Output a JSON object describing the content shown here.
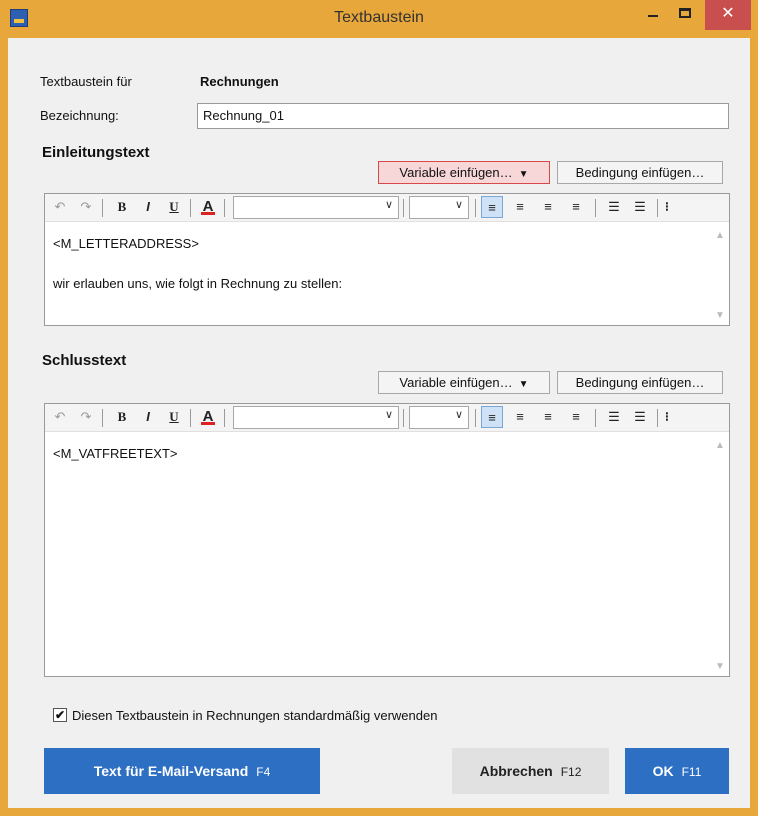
{
  "window": {
    "title": "Textbaustein",
    "close_glyph": "✕"
  },
  "form": {
    "for_label": "Textbaustein für",
    "for_value": "Rechnungen",
    "name_label": "Bezeichnung:",
    "name_value": "Rechnung_01"
  },
  "intro": {
    "title": "Einleitungstext",
    "variable_button": "Variable einfügen…",
    "condition_button": "Bedingung einfügen…",
    "content_lines": [
      "<M_LETTERADDRESS>",
      "wir erlauben uns, wie folgt in Rechnung zu stellen:"
    ]
  },
  "closing": {
    "title": "Schlusstext",
    "variable_button": "Variable einfügen…",
    "condition_button": "Bedingung einfügen…",
    "content_lines": [
      "<M_VATFREETEXT>"
    ]
  },
  "toolbar": {
    "undo_glyph": "↶",
    "redo_glyph": "↷",
    "bold_glyph": "B",
    "italic_glyph": "I",
    "underline_glyph": "U",
    "font_color_glyph": "A",
    "combo_arrow": "∨",
    "align_left_glyph": "≡",
    "align_center_glyph": "≡",
    "align_right_glyph": "≡",
    "justify_glyph": "≡",
    "bullets_glyph": "☰",
    "numbering_glyph": "☰",
    "more_glyph": "⁝"
  },
  "default_checkbox": {
    "checked": true,
    "check_glyph": "✔",
    "label": "Diesen Textbaustein in Rechnungen standardmäßig verwenden"
  },
  "buttons": {
    "email_label": "Text für E-Mail-Versand",
    "email_key": "F4",
    "cancel_label": "Abbrechen",
    "cancel_key": "F12",
    "ok_label": "OK",
    "ok_key": "F11"
  },
  "colors": {
    "window_border": "#e8a73a",
    "close_button": "#c94f4f",
    "primary_button": "#2c6fc3",
    "highlight_border": "#d84a4a"
  }
}
